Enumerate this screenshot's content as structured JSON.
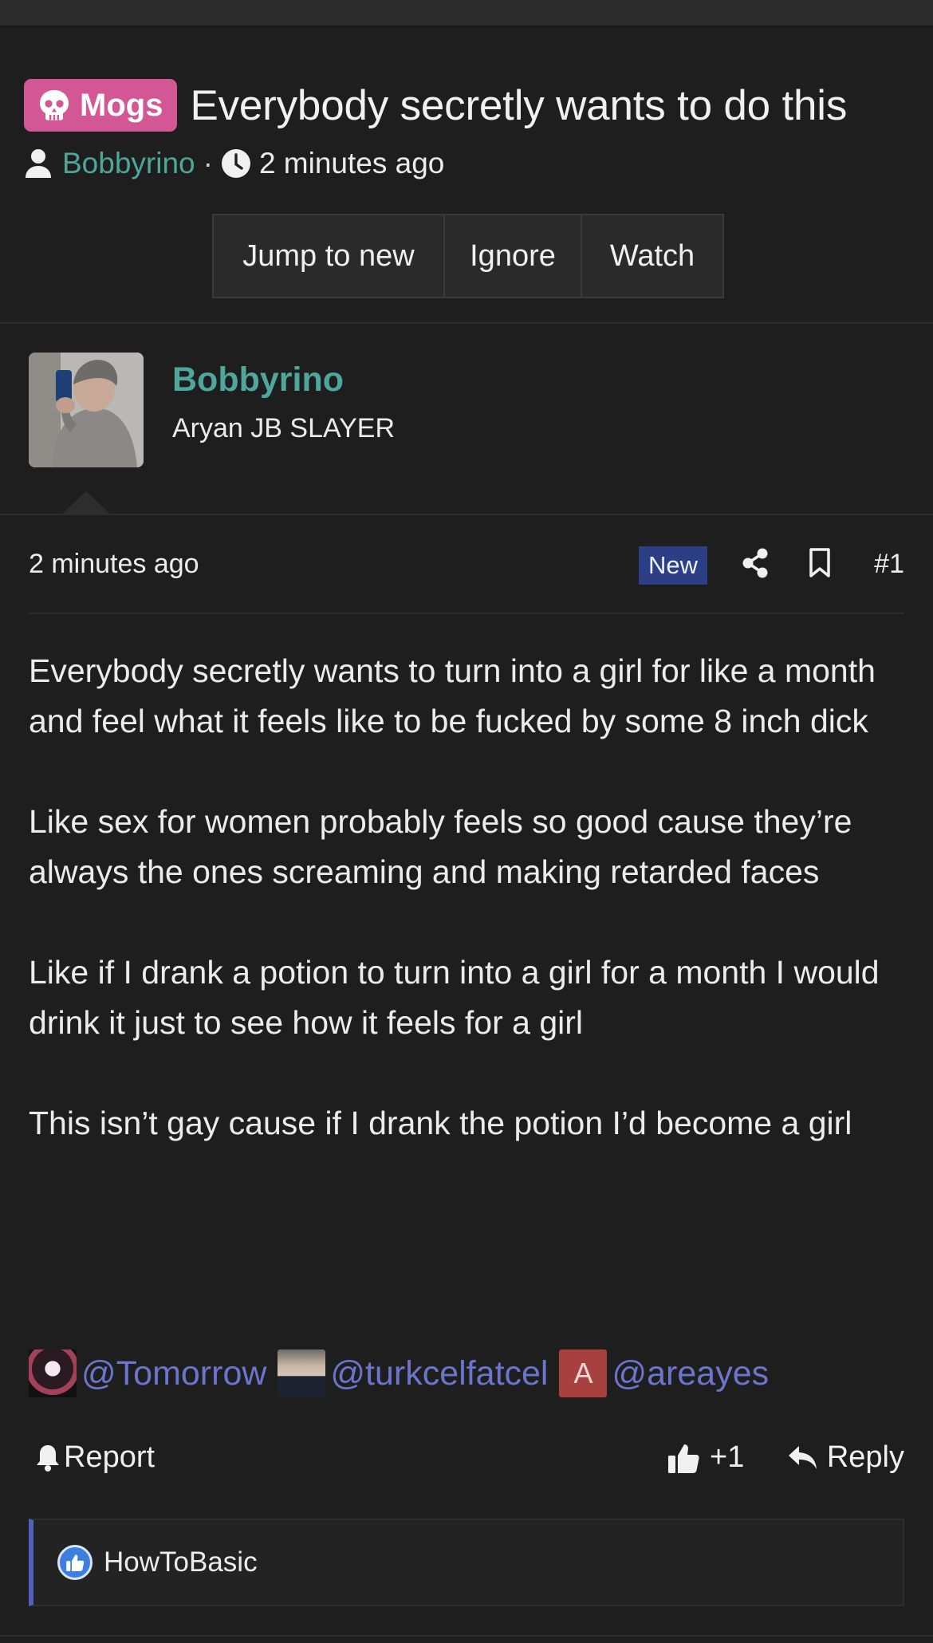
{
  "thread": {
    "prefix_label": "Mogs",
    "title": "Everybody secretly wants to do this",
    "author": "Bobbyrino",
    "separator": "·",
    "time": "2 minutes ago",
    "buttons": {
      "jump_to_new": "Jump to new",
      "ignore": "Ignore",
      "watch": "Watch"
    }
  },
  "post": {
    "user": {
      "name": "Bobbyrino",
      "title": "Aryan JB SLAYER"
    },
    "time": "2 minutes ago",
    "new_badge": "New",
    "number": "#1",
    "paragraphs": [
      "Everybody secretly wants to turn into a girl for like a month and feel what it feels like to be fucked by some 8 inch dick",
      "Like sex for women probably feels so good cause they’re always the ones screaming and making retarded faces",
      "Like if I drank a potion to turn into a girl for a month I would drink it just to see how it feels for a girl",
      "This isn’t gay cause if I drank the potion I’d become a girl"
    ],
    "mentions": [
      {
        "handle": "@Tomorrow"
      },
      {
        "handle": "@turkcelfatcel"
      },
      {
        "handle": "@areayes",
        "avatar_letter": "A"
      }
    ],
    "actions": {
      "report": "Report",
      "like": "+1",
      "reply": "Reply"
    },
    "reactions": {
      "icon": "like-icon",
      "user": "HowToBasic"
    }
  },
  "colors": {
    "background": "#1e1e1f",
    "prefix": "#d45795",
    "username": "#4fa69a",
    "mention": "#6b75cc",
    "new_badge": "#2c3f86",
    "reaction_accent": "#5360b8"
  }
}
